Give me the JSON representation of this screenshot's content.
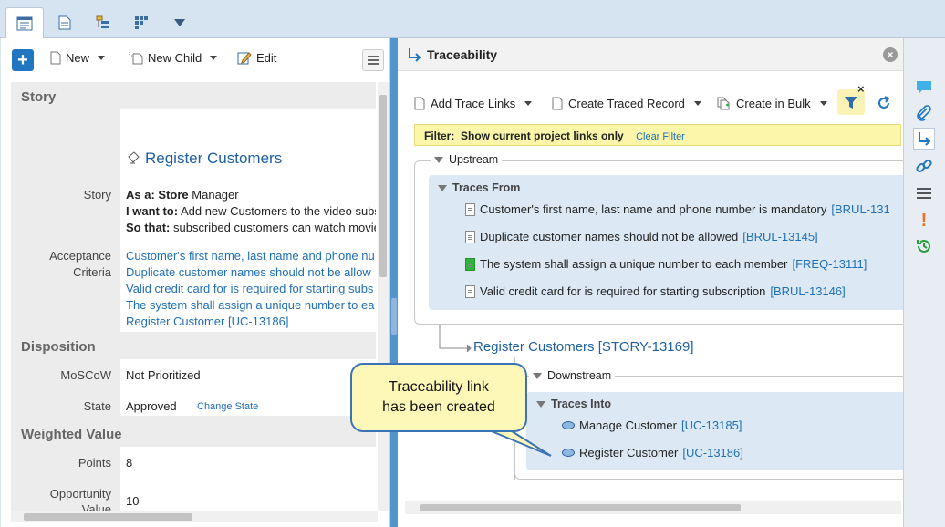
{
  "top_tabs": [
    {
      "icon": "form-icon",
      "active": true
    },
    {
      "icon": "document-icon"
    },
    {
      "icon": "tree-icon"
    },
    {
      "icon": "grid-icon"
    },
    {
      "icon": "chevron-down-icon"
    }
  ],
  "left_toolbar": {
    "new_label": "New",
    "new_child_label": "New Child",
    "edit_label": "Edit"
  },
  "story_section": {
    "title": "Story",
    "record_title": "Register Customers",
    "story_label": "Story",
    "as_a_bold": "As a:",
    "as_a_role_bold": "Store",
    "as_a_role_rest": "Manager",
    "i_want_bold": "I want to:",
    "i_want_text": "Add new Customers to the video subs",
    "so_that_bold": "So that:",
    "so_that_text": "subscribed customers can watch movie",
    "acceptance_label_1": "Acceptance",
    "acceptance_label_2": "Criteria",
    "acceptance_items": [
      "Customer's first name, last name and phone nu",
      "Duplicate customer names should not be allow",
      "Valid credit card for is required for starting subs",
      "The system shall assign a unique number to ea",
      "Register Customer [UC-13186]"
    ]
  },
  "disposition_section": {
    "title": "Disposition",
    "moscow_label": "MoSCoW",
    "moscow_value": "Not Prioritized",
    "state_label": "State",
    "state_value": "Approved",
    "change_state_link": "Change State"
  },
  "weighted_section": {
    "title": "Weighted Value",
    "points_label": "Points",
    "points_value": "8",
    "opportunity_label_1": "Opportunity",
    "opportunity_label_2": "Value",
    "opportunity_value": "10"
  },
  "trace_panel": {
    "title": "Traceability",
    "add_trace_links": "Add Trace Links",
    "create_traced_record": "Create Traced Record",
    "create_in_bulk": "Create in Bulk",
    "filter_label": "Filter:",
    "filter_text": "Show current project links only",
    "clear_filter": "Clear Filter",
    "upstream_label": "Upstream",
    "traces_from_label": "Traces From",
    "traces_from": [
      {
        "text": "Customer's first name, last name and phone number is mandatory ",
        "id": "[BRUL-131",
        "icon": "white"
      },
      {
        "text": "Duplicate customer names should not be allowed ",
        "id": "[BRUL-13145]",
        "icon": "white"
      },
      {
        "text": "The system shall assign a unique number to each member ",
        "id": "[FREQ-13111]",
        "icon": "green"
      },
      {
        "text": "Valid credit card for is required for starting subscription ",
        "id": "[BRUL-13146]",
        "icon": "white"
      }
    ],
    "current_record": "Register Customers [STORY-13169]",
    "downstream_label": "Downstream",
    "traces_into_label": "Traces Into",
    "traces_into": [
      {
        "text": "Manage Customer ",
        "id": "[UC-13185]"
      },
      {
        "text": "Register Customer ",
        "id": "[UC-13186]"
      }
    ]
  },
  "right_strip_icons": [
    "comment-icon",
    "attachment-icon",
    "trace-icon",
    "link-icon",
    "list-icon",
    "alert-icon",
    "history-icon"
  ],
  "callout": {
    "line1": "Traceability link",
    "line2": "has been created"
  },
  "colors": {
    "link": "#1f6fb8",
    "accent": "#3a86c8",
    "filter_bar": "#fbf6a9",
    "callout_bg": "#fdf8b7"
  }
}
